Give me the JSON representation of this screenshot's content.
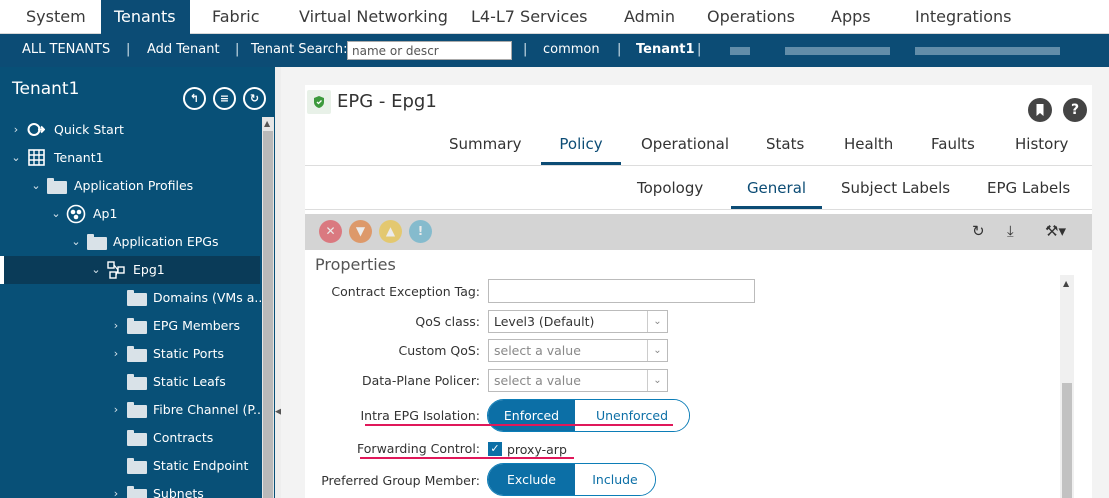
{
  "topnav": {
    "tabs": [
      "System",
      "Tenants",
      "Fabric",
      "Virtual Networking",
      "L4-L7 Services",
      "Admin",
      "Operations",
      "Apps",
      "Integrations"
    ]
  },
  "subnav": {
    "all_tenants": "ALL TENANTS",
    "add_tenant": "Add Tenant",
    "search_label": "Tenant Search:",
    "search_placeholder": "name or descr",
    "common": "common",
    "tenant1": "Tenant1",
    "sep": "|"
  },
  "leftpanel": {
    "title": "Tenant1",
    "tree": [
      {
        "label": "Quick Start"
      },
      {
        "label": "Tenant1"
      },
      {
        "label": "Application Profiles"
      },
      {
        "label": "Ap1"
      },
      {
        "label": "Application EPGs"
      },
      {
        "label": "Epg1"
      },
      {
        "label": "Domains (VMs a..."
      },
      {
        "label": "EPG Members"
      },
      {
        "label": "Static Ports"
      },
      {
        "label": "Static Leafs"
      },
      {
        "label": "Fibre Channel (P..."
      },
      {
        "label": "Contracts"
      },
      {
        "label": "Static Endpoint"
      },
      {
        "label": "Subnets"
      }
    ]
  },
  "main": {
    "title": "EPG - Epg1",
    "tabs": [
      "Summary",
      "Policy",
      "Operational",
      "Stats",
      "Health",
      "Faults",
      "History"
    ],
    "subtabs": [
      "Topology",
      "General",
      "Subject Labels",
      "EPG Labels"
    ],
    "properties_title": "Properties",
    "fields": {
      "contract_exception_tag": "Contract Exception Tag:",
      "qos_class": "QoS class:",
      "qos_class_value": "Level3 (Default)",
      "custom_qos": "Custom QoS:",
      "custom_qos_placeholder": "select a value",
      "data_plane_policer": "Data-Plane Policer:",
      "data_plane_policer_placeholder": "select a value",
      "intra_epg_isolation": "Intra EPG Isolation:",
      "isolation_enforced": "Enforced",
      "isolation_unenforced": "Unenforced",
      "forwarding_control": "Forwarding Control:",
      "proxy_arp": "proxy-arp",
      "preferred_group_member": "Preferred Group Member:",
      "pgm_exclude": "Exclude",
      "pgm_include": "Include"
    }
  },
  "colors": {
    "brand": "#0c4c75",
    "highlight": "#e0185a"
  }
}
